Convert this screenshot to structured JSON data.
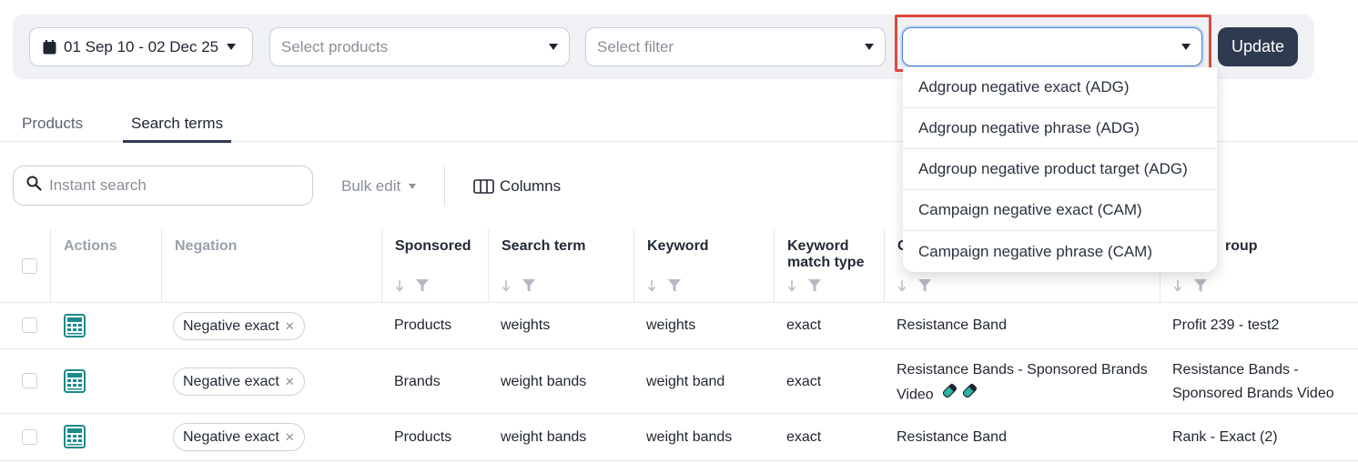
{
  "toolbar": {
    "date_range": "01 Sep 10 - 02 Dec 25",
    "products_placeholder": "Select products",
    "filter_placeholder": "Select filter",
    "negation_value": "",
    "update_label": "Update"
  },
  "tabs": [
    {
      "label": "Products",
      "active": false
    },
    {
      "label": "Search terms",
      "active": true
    }
  ],
  "search": {
    "placeholder": "Instant search"
  },
  "bulk_edit": {
    "label": "Bulk edit"
  },
  "columns_button": {
    "label": "Columns"
  },
  "table": {
    "headers": {
      "actions": "Actions",
      "negation": "Negation",
      "sponsored": "Sponsored",
      "search_term": "Search term",
      "keyword": "Keyword",
      "keyword_match_type": "Keyword match type",
      "campaign": "C",
      "adgroup": "roup"
    },
    "rows": [
      {
        "negation": "Negative exact",
        "sponsored": "Products",
        "search_term": "weights",
        "keyword": "weights",
        "match_type": "exact",
        "campaign": "Resistance Band",
        "adgroup": "Profit 239 - test2"
      },
      {
        "negation": "Negative exact",
        "sponsored": "Brands",
        "search_term": "weight bands",
        "keyword": "weight band",
        "match_type": "exact",
        "campaign": "Resistance Bands - Sponsored Brands Video",
        "adgroup": "Resistance Bands - Sponsored Brands Video"
      },
      {
        "negation": "Negative exact",
        "sponsored": "Products",
        "search_term": "weight bands",
        "keyword": "weight bands",
        "match_type": "exact",
        "campaign": "Resistance Band",
        "adgroup": "Rank - Exact (2)"
      }
    ]
  },
  "dropdown": {
    "options": [
      "Adgroup negative exact (ADG)",
      "Adgroup negative phrase (ADG)",
      "Adgroup negative product target (ADG)",
      "Campaign negative exact (CAM)",
      "Campaign negative phrase (CAM)"
    ]
  },
  "colors": {
    "accent": "#2e3a4f",
    "highlight": "#e0483d",
    "icon_teal": "#1a8a8a"
  }
}
